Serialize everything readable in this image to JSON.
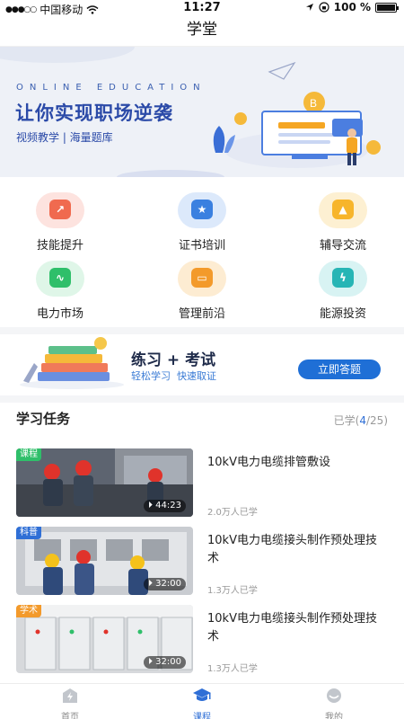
{
  "status_bar": {
    "carrier": "中国移动",
    "time": "11:27",
    "battery": "100 %",
    "battery_level": 1.0
  },
  "nav": {
    "title": "学堂"
  },
  "banner": {
    "english": "ONLINE EDUCATION",
    "title": "让你实现职场逆袭",
    "subtitle": "视频教学 | 海量题库"
  },
  "categories": [
    {
      "label": "技能提升",
      "icon": "skill-arrow-icon",
      "bg": "#fde3df",
      "fg": "#f06a4f"
    },
    {
      "label": "证书培训",
      "icon": "certificate-badge-icon",
      "bg": "#dce9fb",
      "fg": "#3a80e0"
    },
    {
      "label": "辅导交流",
      "icon": "graduation-cap-icon",
      "bg": "#fdf0d2",
      "fg": "#f7b52b"
    },
    {
      "label": "电力市场",
      "icon": "wave-chart-icon",
      "bg": "#dff6e8",
      "fg": "#2fbf6a"
    },
    {
      "label": "管理前沿",
      "icon": "inbox-tray-icon",
      "bg": "#fdecd2",
      "fg": "#f39a2b"
    },
    {
      "label": "能源投资",
      "icon": "lightning-shield-icon",
      "bg": "#d8f3f3",
      "fg": "#27b5b5"
    }
  ],
  "practice": {
    "title": "练习 + 考试",
    "subtitle_1": "轻松学习",
    "subtitle_2": "快速取证",
    "button": "立即答题"
  },
  "tasks_header": {
    "title": "学习任务",
    "learned_prefix": "已学(",
    "learned": "4",
    "total": "/25)"
  },
  "tasks": [
    {
      "tag": "课程",
      "tag_color": "#2fbf6a",
      "duration": "44:23",
      "title": "10kV电力电缆排管敷设",
      "meta": "2.0万人已学"
    },
    {
      "tag": "科普",
      "tag_color": "#2f6fd6",
      "duration": "32:00",
      "title": "10kV电力电缆接头制作预处理技术",
      "meta": "1.3万人已学"
    },
    {
      "tag": "学术",
      "tag_color": "#f39a2b",
      "duration": "32:00",
      "title": "10kV电力电缆接头制作预处理技术",
      "meta": "1.3万人已学"
    }
  ],
  "tabbar": {
    "items": [
      {
        "label": "首页",
        "icon": "home-bolt-icon"
      },
      {
        "label": "课程",
        "icon": "graduation-cap-icon",
        "active": true
      },
      {
        "label": "我的",
        "icon": "user-face-icon"
      }
    ]
  },
  "colors": {
    "accent": "#2f6fd6",
    "banner_title": "#2b4aa8"
  }
}
